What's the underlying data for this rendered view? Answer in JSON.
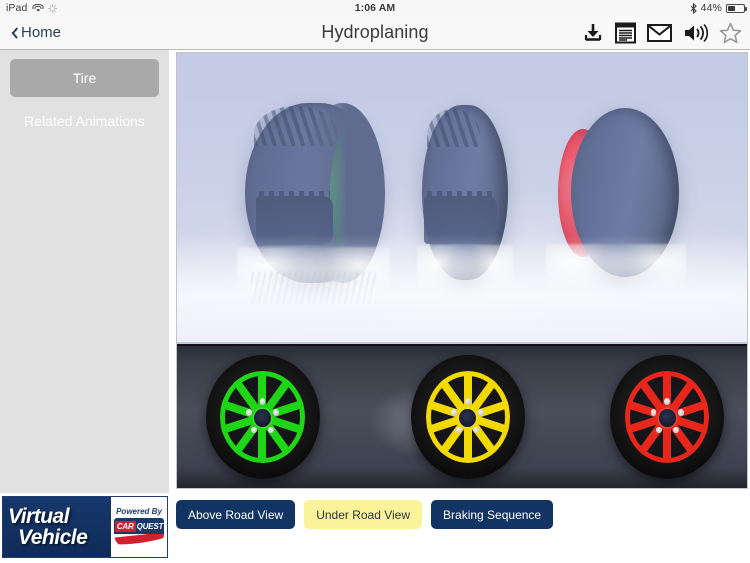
{
  "status_bar": {
    "device": "iPad",
    "wifi_icon": "wifi-icon",
    "activity_icon": "activity-spinner-icon",
    "time": "1:06 AM",
    "bluetooth_icon": "bluetooth-icon",
    "battery_percent": "44%",
    "battery_icon": "battery-icon",
    "battery_level": 44
  },
  "nav_bar": {
    "back_label": "Home",
    "back_icon": "chevron-left-icon",
    "title": "Hydroplaning",
    "icons": [
      {
        "name": "download-icon",
        "label": "Download"
      },
      {
        "name": "notes-icon",
        "label": "Notes"
      },
      {
        "name": "mail-icon",
        "label": "Email"
      },
      {
        "name": "speaker-icon",
        "label": "Audio"
      },
      {
        "name": "star-icon",
        "label": "Favorite"
      }
    ]
  },
  "sidebar": {
    "items": [
      {
        "label": "Tire",
        "selected": true
      },
      {
        "label": "Related Animations",
        "selected": false
      }
    ]
  },
  "stage": {
    "top_scene": {
      "description": "Side view of three rolling tires through water",
      "tires": [
        {
          "rim_color": "#3fd65c",
          "rim_name": "green"
        },
        {
          "rim_color": "#6f7ca4",
          "rim_name": "none-visible"
        },
        {
          "rim_color": "#ff5f72",
          "rim_name": "pink"
        }
      ]
    },
    "bottom_scene": {
      "description": "Front view of three wheels on wet asphalt",
      "wheels": [
        {
          "rim_color": "#1fd616",
          "rim_name": "green"
        },
        {
          "rim_color": "#f2d900",
          "rim_name": "yellow"
        },
        {
          "rim_color": "#e8271c",
          "rim_name": "red"
        }
      ]
    }
  },
  "logo": {
    "line1": "Virtual",
    "line2": "Vehicle",
    "powered_by": "Powered By",
    "brand_car": "CAR",
    "brand_quest": "QUEST"
  },
  "view_buttons": [
    {
      "label": "Above Road View",
      "active": false
    },
    {
      "label": "Under Road View",
      "active": true
    },
    {
      "label": "Braking Sequence",
      "active": false
    }
  ],
  "colors": {
    "nav_text": "#3b3b3b",
    "back_blue": "#2e4057",
    "button_navy": "#123463",
    "button_yellow": "#faf39a",
    "sidebar_bg": "#e1e1e1",
    "sidebar_selected": "#a9a9a9",
    "logo_navy": "#17386c",
    "carquest_red": "#d1202f"
  }
}
